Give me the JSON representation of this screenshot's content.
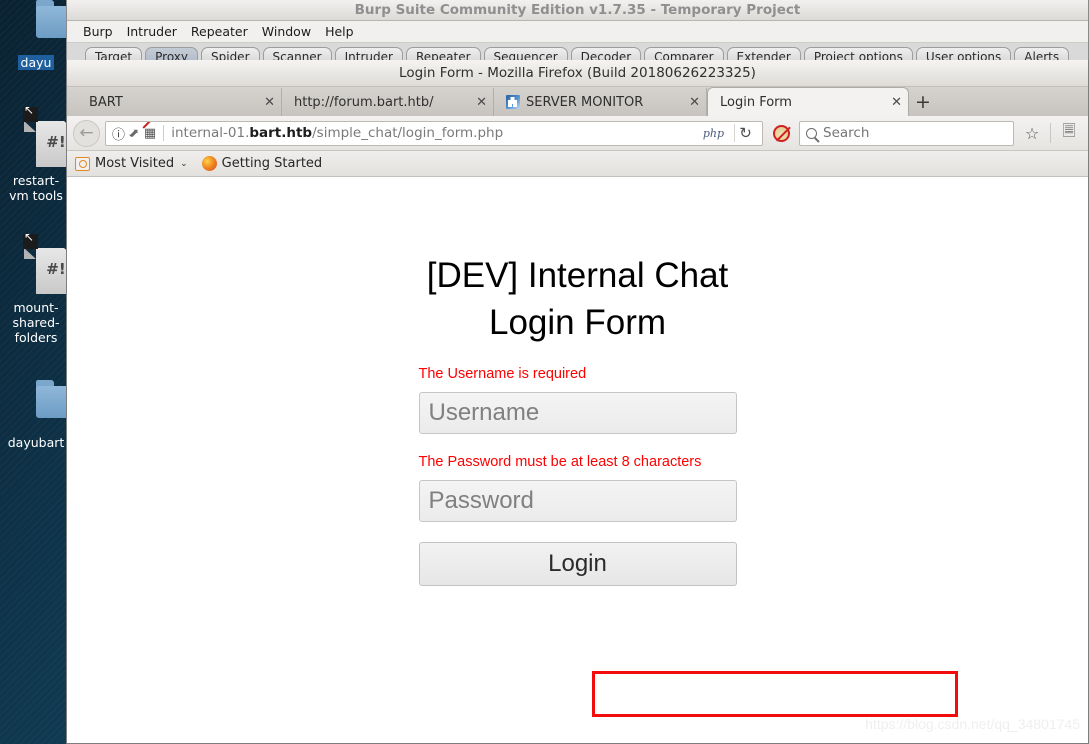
{
  "desktop": {
    "icons": [
      {
        "label": "dayu",
        "type": "folder",
        "selected": true
      },
      {
        "label": "restart-vm tools",
        "type": "script",
        "selected": false
      },
      {
        "label": "mount-shared-folders",
        "type": "script",
        "selected": false
      },
      {
        "label": "dayubart",
        "type": "folder",
        "selected": false
      }
    ]
  },
  "burp": {
    "title": "Burp Suite Community Edition v1.7.35 - Temporary Project",
    "menu": [
      "Burp",
      "Intruder",
      "Repeater",
      "Window",
      "Help"
    ],
    "tabs": [
      "Target",
      "Proxy",
      "Spider",
      "Scanner",
      "Intruder",
      "Repeater",
      "Sequencer",
      "Decoder",
      "Comparer",
      "Extender",
      "Project options",
      "User options",
      "Alerts"
    ],
    "active_tab": "Proxy"
  },
  "firefox": {
    "title": "Login Form - Mozilla Firefox (Build 20180626223325)",
    "tabs": [
      {
        "label": "BART",
        "active": false,
        "favicon": false,
        "close": "✕"
      },
      {
        "label": "http://forum.bart.htb/",
        "active": false,
        "favicon": false,
        "close": "✕"
      },
      {
        "label": "SERVER MONITOR",
        "active": false,
        "favicon": true,
        "close": "✕"
      },
      {
        "label": "Login Form",
        "active": true,
        "favicon": false,
        "close": "✕"
      }
    ],
    "new_tab_label": "+",
    "navbar": {
      "back_glyph": "←",
      "identity_info": "ⓘ",
      "identity_key": "⚷",
      "url_prefix": "internal-01.",
      "url_host": "bart.htb",
      "url_suffix": "/simple_chat/login_form.php",
      "url_full": "internal-01.bart.htb/simple_chat/login_form.php",
      "php_badge": "php",
      "reload_glyph": "↻",
      "search_placeholder": "Search",
      "search_value": "",
      "star_glyph": "☆",
      "library_glyph": "☰"
    },
    "bookmarks": [
      {
        "label": "Most Visited",
        "icon": "most-visited-icon",
        "caret": "⌄"
      },
      {
        "label": "Getting Started",
        "icon": "firefox-icon",
        "caret": ""
      }
    ]
  },
  "page": {
    "heading": "[DEV] Internal Chat Login Form",
    "username_error": "The Username is required",
    "password_error": "The Password must be at least 8 characters",
    "username_placeholder": "Username",
    "username_value": "",
    "password_placeholder": "Password",
    "password_value": "",
    "login_label": "Login",
    "watermark": "https://blog.csdn.net/qq_34801745",
    "colors": {
      "error_text": "#ff0000",
      "annotation_box": "#f20c0c",
      "heading": "#000000"
    }
  }
}
